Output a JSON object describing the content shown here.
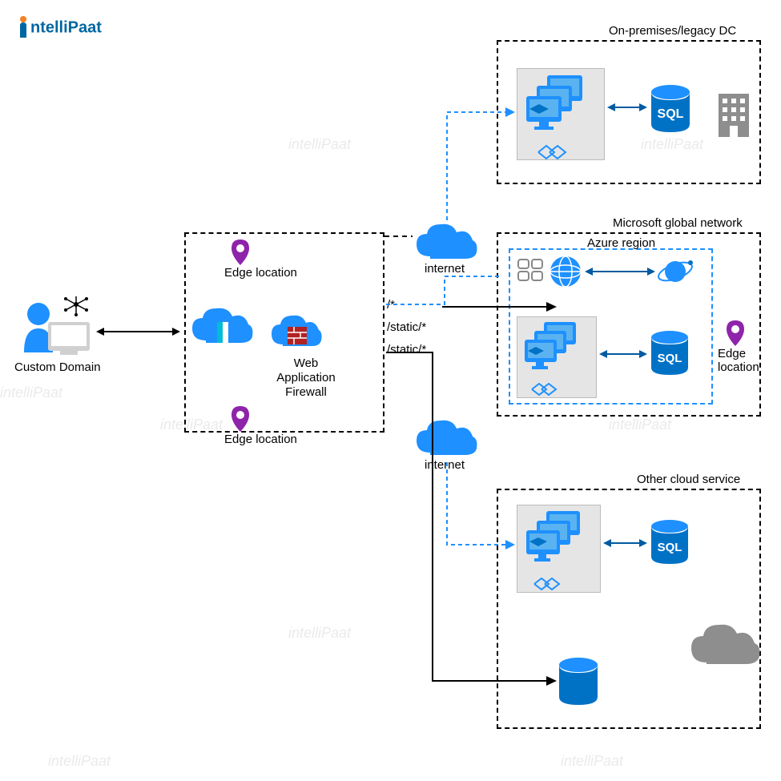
{
  "logo": {
    "part1": "i",
    "part2": "ntelliPaat"
  },
  "labels": {
    "customDomain": "Custom Domain",
    "edgeLocation": "Edge location",
    "waf": "Web Application Firewall",
    "internet": "internet",
    "onPrem": "On-premises/legacy DC",
    "msGlobal": "Microsoft global network",
    "azureRegion": "Azure region",
    "otherCloud": "Other cloud service",
    "sql": "SQL"
  },
  "paths": {
    "root": "/*",
    "static1": "/static/*",
    "static2": "/static/*"
  },
  "colors": {
    "azure": "#1e90ff",
    "darkblue": "#0072c6",
    "orange": "#f58220",
    "gray": "#8e8e8e",
    "purple": "#8e24aa"
  },
  "watermark": "intelliPaat"
}
